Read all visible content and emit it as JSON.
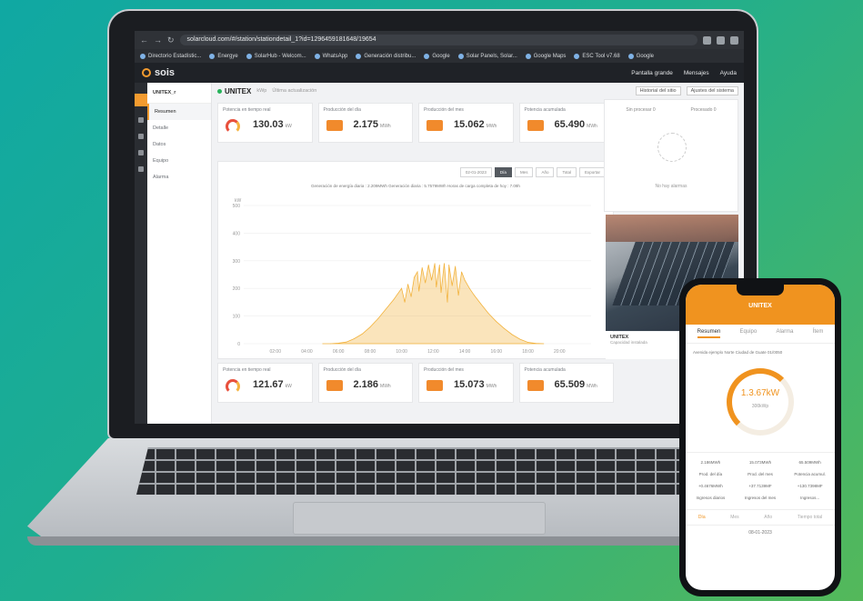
{
  "browser": {
    "url": "solarcloud.com/#/station/stationdetail_1?id=1296459181648/19654",
    "bookmarks": [
      "Directorio Estadístic...",
      "Energye",
      "SolarHub - Welcom...",
      "WhatsApp",
      "Generación distribu...",
      "Google",
      "Solar Panels, Solar...",
      "Google Maps",
      "ESC Tool v7.68",
      "Google"
    ]
  },
  "app": {
    "logo": "sois",
    "header_links": [
      "Pantalla grande",
      "Mensajes",
      "Ayuda"
    ],
    "sidebar": {
      "station": "UNITEX_r",
      "items": [
        "Resumen",
        "Detalle",
        "Datos",
        "Equipo",
        "Alarma"
      ]
    },
    "topbar": {
      "station": "UNITEX",
      "capacity": "kWp",
      "updated": "Última actualización",
      "tags": [
        "Historial del sitio",
        "Ajustes del sistema"
      ]
    },
    "cards_top": [
      {
        "title": "Potencia en tiempo real",
        "value": "130.03",
        "unit": "kW",
        "icon": "gauge-icon"
      },
      {
        "title": "Producción del día",
        "value": "2.175",
        "unit": "MWh",
        "icon": "battery-icon"
      },
      {
        "title": "Producción del mes",
        "value": "15.062",
        "unit": "MWh",
        "icon": "calendar-icon"
      },
      {
        "title": "Potencia acumulada",
        "value": "65.490",
        "unit": "MWh",
        "icon": "stack-icon"
      }
    ],
    "cards_bottom": [
      {
        "title": "Potencia en tiempo real",
        "value": "121.67",
        "unit": "kW"
      },
      {
        "title": "Producción del día",
        "value": "2.186",
        "unit": "MWh"
      },
      {
        "title": "Producción del mes",
        "value": "15.073",
        "unit": "MWh"
      },
      {
        "title": "Potencia acumulada",
        "value": "65.509",
        "unit": "MWh"
      }
    ],
    "chart_controls": {
      "date": "02-01-2023",
      "ranges": [
        "Día",
        "Mes",
        "Año",
        "Total",
        "Exportar"
      ],
      "active": "Día"
    },
    "chart_summary": "Generación de energía diaria : 2.209MWh     Generación diaria : 5.7579MWh     Horas de carga completa de hoy : 7.09h",
    "alarm_panel": {
      "tabs": [
        "Sin procesar 0",
        "Procesado 0"
      ],
      "empty": "No hay alarmas"
    },
    "plant_name": "UNITEX",
    "plant_info": "Capacidad instalada"
  },
  "chart_data": {
    "type": "area",
    "x": [
      "02:00",
      "04:00",
      "06:00",
      "08:00",
      "10:00",
      "12:00",
      "14:00",
      "16:00",
      "18:00",
      "20:00"
    ],
    "xlabel": "",
    "ylabel": "kW",
    "ylim": [
      0,
      500
    ],
    "yticks": [
      0,
      100,
      200,
      300,
      400,
      500
    ],
    "series": [
      {
        "values": [
          [
            5.0,
            0
          ],
          [
            5.5,
            0
          ],
          [
            6.0,
            2
          ],
          [
            6.5,
            6
          ],
          [
            7.0,
            18
          ],
          [
            7.5,
            35
          ],
          [
            8.0,
            60
          ],
          [
            8.5,
            90
          ],
          [
            9.0,
            125
          ],
          [
            9.5,
            160
          ],
          [
            10.0,
            200
          ],
          [
            10.2,
            150
          ],
          [
            10.4,
            215
          ],
          [
            10.6,
            170
          ],
          [
            10.8,
            240
          ],
          [
            11.0,
            260
          ],
          [
            11.1,
            190
          ],
          [
            11.3,
            275
          ],
          [
            11.5,
            220
          ],
          [
            11.7,
            285
          ],
          [
            11.9,
            230
          ],
          [
            12.1,
            290
          ],
          [
            12.2,
            205
          ],
          [
            12.4,
            285
          ],
          [
            12.5,
            185
          ],
          [
            12.7,
            290
          ],
          [
            12.9,
            150
          ],
          [
            13.0,
            285
          ],
          [
            13.2,
            210
          ],
          [
            13.4,
            280
          ],
          [
            13.6,
            175
          ],
          [
            13.8,
            260
          ],
          [
            14.0,
            230
          ],
          [
            14.3,
            200
          ],
          [
            14.6,
            175
          ],
          [
            15.0,
            145
          ],
          [
            15.5,
            110
          ],
          [
            16.0,
            80
          ],
          [
            16.5,
            55
          ],
          [
            17.0,
            33
          ],
          [
            17.5,
            16
          ],
          [
            18.0,
            5
          ],
          [
            18.5,
            1
          ],
          [
            19.0,
            0
          ]
        ],
        "color": "#f2b23c"
      }
    ]
  },
  "phone": {
    "station": "UNITEX",
    "tabs": [
      "Resumen",
      "Equipo",
      "Alarma",
      "Ítem"
    ],
    "address": "Avenida ejemplo Norte Ciudad de Guate 01/0050",
    "power_label": "Potencia",
    "power_value": "1.3.67kW",
    "capacity": "300kWp",
    "stats": [
      "2.186MWh",
      "15.073MWh",
      "65.509MWh",
      "Prod. del día",
      "Prod. del mes",
      "Potencia acumul.",
      "+0.4676MWh",
      "+37.7139MF",
      "+130.7398MF",
      "Ingresos diarios",
      "Ingresos del mes",
      "Ingresos..."
    ],
    "ranges": [
      "Día",
      "Mes",
      "Año",
      "Tiempo total"
    ],
    "date": "08-01-2023"
  }
}
